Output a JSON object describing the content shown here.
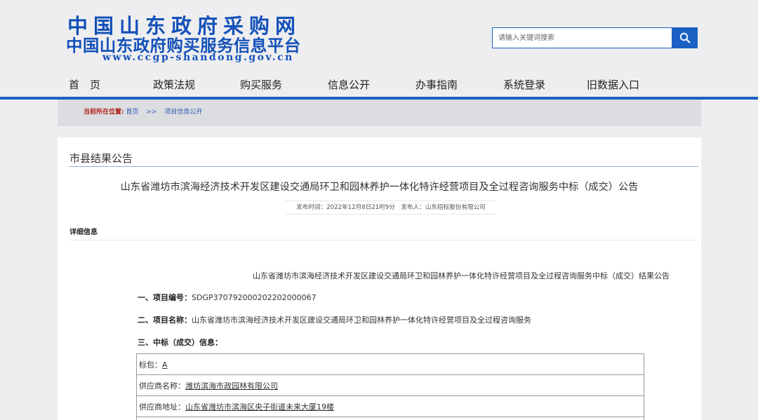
{
  "header": {
    "logo_line1": "中国山东政府采购网",
    "logo_line2": "中国山东政府购买服务信息平台",
    "logo_line3": "www.ccgp-shandong.gov.cn"
  },
  "search": {
    "placeholder": "请输入关键词搜索",
    "icon": "search-icon"
  },
  "nav": {
    "items": [
      "首　页",
      "政策法规",
      "购买服务",
      "信息公开",
      "办事指南",
      "系统登录",
      "旧数据入口"
    ]
  },
  "breadcrumb": {
    "label": "当前所在位置:",
    "home": "首页",
    "separator": ">>",
    "current": "项目信息公开"
  },
  "section": {
    "title": "市县结果公告"
  },
  "doc": {
    "title": "山东省潍坊市滨海经济技术开发区建设交通局环卫和园林养护一体化特许经营项目及全过程咨询服务中标（成交）公告",
    "meta": "发布时间：2022年12月8日21时9分　发布人：山东招标股份有限公司",
    "detail_heading": "详细信息",
    "announcement_title": "山东省潍坊市滨海经济技术开发区建设交通局环卫和园林养护一体化特许经营项目及全过程咨询服务中标（成交）结果公告",
    "project_no_label": "一、项目编号：",
    "project_no": "SDGP370792000202202000067",
    "project_name_label": "二、项目名称：",
    "project_name": "山东省潍坊市滨海经济技术开发区建设交通局环卫和园林养护一体化特许经营项目及全过程咨询服务",
    "award_label": "三、中标（成交）信息："
  },
  "table": {
    "rows": [
      {
        "label": "标包：",
        "value": "A"
      },
      {
        "label": "供应商名称：",
        "value": "潍坊滨海市政园林有限公司"
      },
      {
        "label": "供应商地址：",
        "value": "山东省潍坊市滨海区央子街道未来大厦19楼"
      }
    ]
  },
  "colors": {
    "brand_blue": "#1a61c3",
    "logo_blue": "#1451b9",
    "breadcrumb_label": "#b3261e"
  }
}
